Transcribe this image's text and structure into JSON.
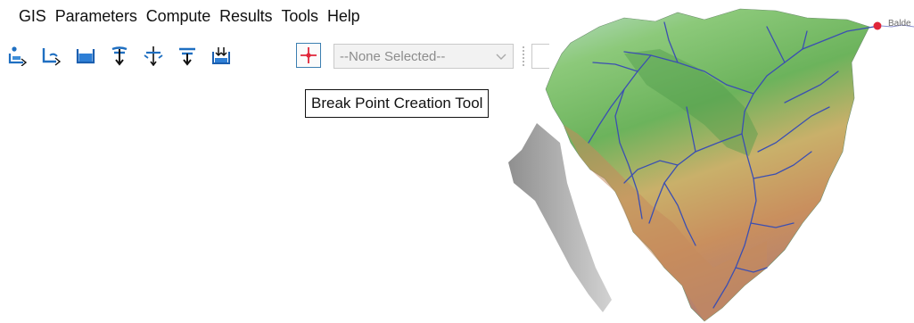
{
  "menu": {
    "items": [
      "GIS",
      "Parameters",
      "Compute",
      "Results",
      "Tools",
      "Help"
    ]
  },
  "toolbar": {
    "tools": [
      {
        "icon": "assign-stream-icon"
      },
      {
        "icon": "stream-network-icon"
      },
      {
        "icon": "flow-accumulation-icon"
      },
      {
        "icon": "flow-direction-icon"
      },
      {
        "icon": "junction-icon"
      },
      {
        "icon": "outlet-icon"
      },
      {
        "icon": "drainage-point-icon"
      },
      {
        "icon": "break-point-icon"
      }
    ],
    "selector": {
      "value": "--None Selected--"
    }
  },
  "tooltip": {
    "text": "Break Point Creation Tool"
  },
  "map": {
    "outlet_label": "Balde",
    "colors": {
      "river": "#3b4fb2",
      "outlet": "#e0263a",
      "lowland": "#5fae5a",
      "highland": "#c98f5e",
      "shadow": "#9a9a9a"
    }
  }
}
